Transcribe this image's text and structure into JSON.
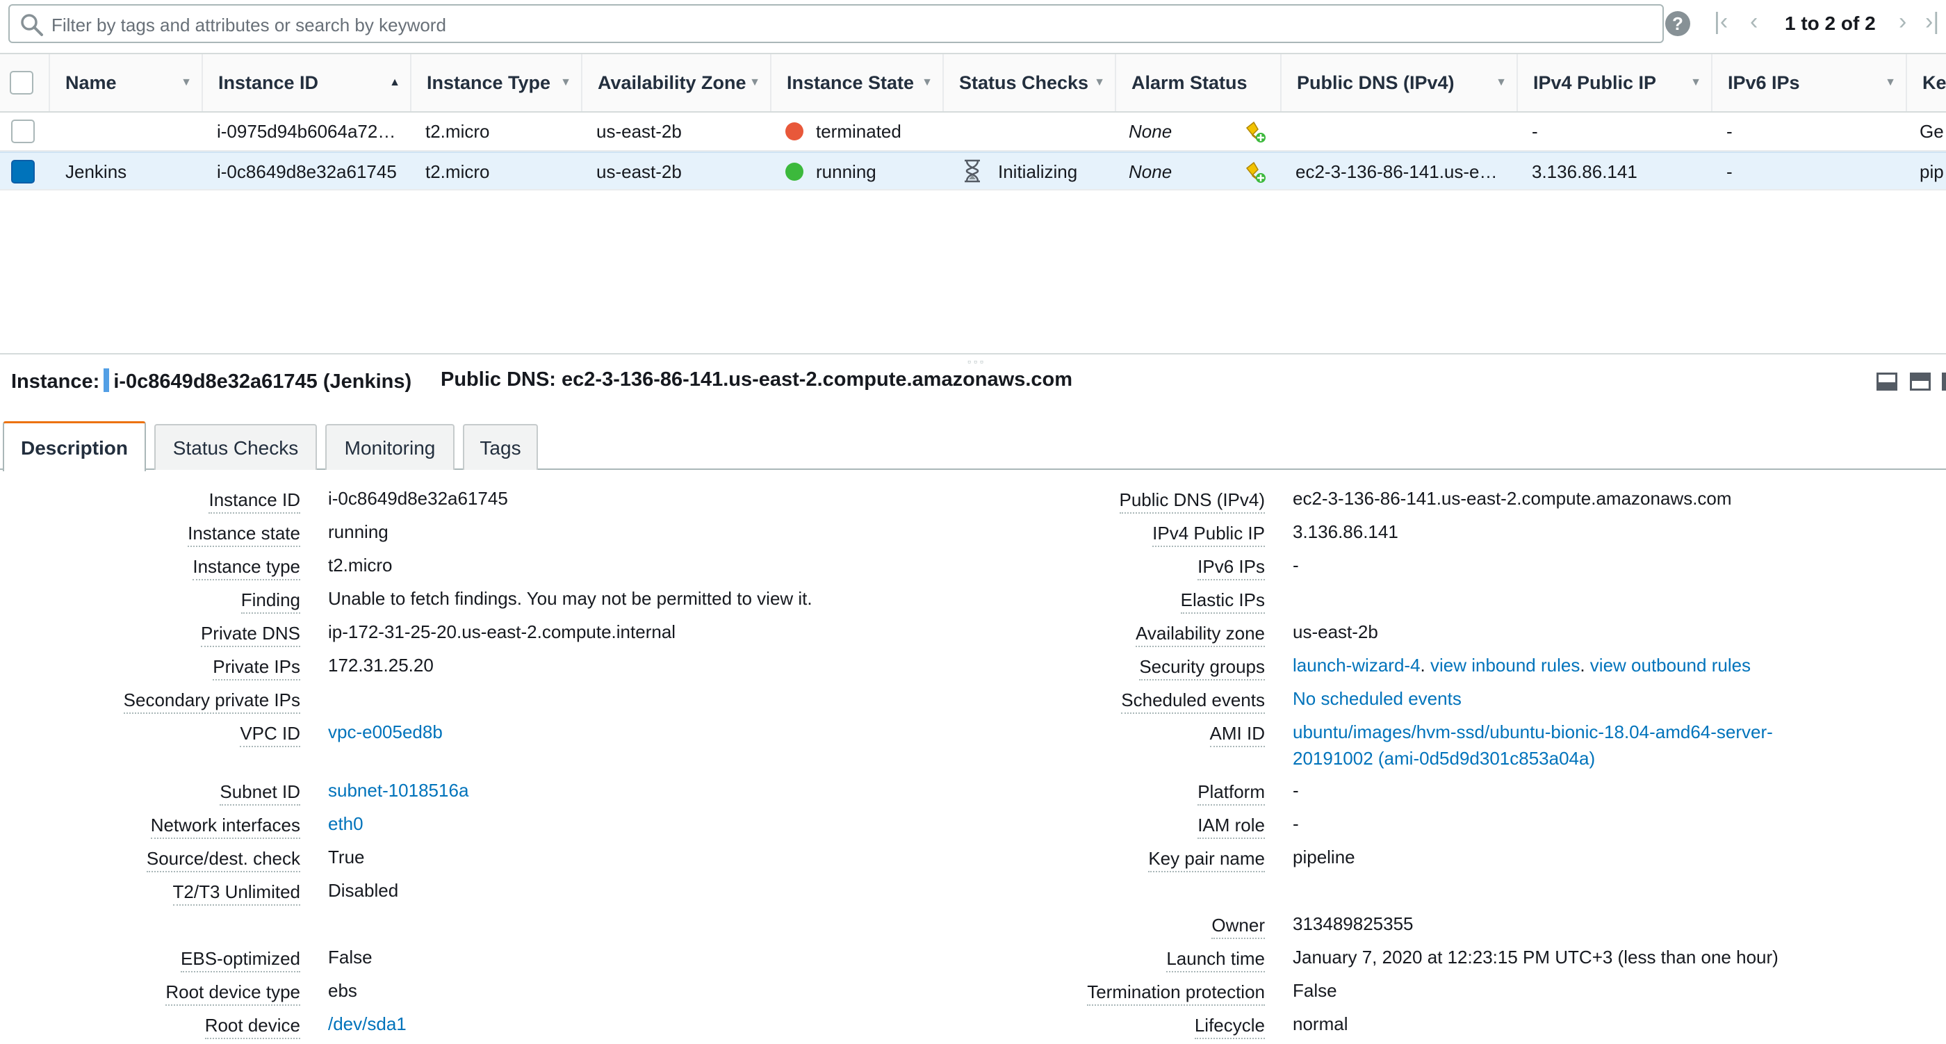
{
  "filter": {
    "placeholder": "Filter by tags and attributes or search by keyword",
    "pager_text": "1 to 2 of 2"
  },
  "grid": {
    "columns": [
      "Name",
      "Instance ID",
      "Instance Type",
      "Availability Zone",
      "Instance State",
      "Status Checks",
      "Alarm Status",
      "Public DNS (IPv4)",
      "IPv4 Public IP",
      "IPv6 IPs",
      "Ke"
    ],
    "rows": [
      {
        "name": "",
        "instance_id": "i-0975d94b6064a72…",
        "instance_type": "t2.micro",
        "az": "us-east-2b",
        "state": "terminated",
        "state_color": "#e8583a",
        "status_checks": "",
        "alarm": "None",
        "public_dns": "",
        "ipv4": "-",
        "ipv6": "-",
        "key": "Ge",
        "selected": false
      },
      {
        "name": "Jenkins",
        "instance_id": "i-0c8649d8e32a61745",
        "instance_type": "t2.micro",
        "az": "us-east-2b",
        "state": "running",
        "state_color": "#3cb93c",
        "status_checks": "Initializing",
        "alarm": "None",
        "public_dns": "ec2-3-136-86-141.us-e…",
        "ipv4": "3.136.86.141",
        "ipv6": "-",
        "key": "pip",
        "selected": true
      }
    ]
  },
  "instance_header": {
    "instance_label": "Instance:",
    "instance_value": "i-0c8649d8e32a61745 (Jenkins)",
    "dns_label": "Public DNS:",
    "dns_value": "ec2-3-136-86-141.us-east-2.compute.amazonaws.com"
  },
  "tabs": [
    "Description",
    "Status Checks",
    "Monitoring",
    "Tags"
  ],
  "description": {
    "left": [
      {
        "label": "Instance ID",
        "value": "i-0c8649d8e32a61745"
      },
      {
        "label": "Instance state",
        "value": "running"
      },
      {
        "label": "Instance type",
        "value": "t2.micro"
      },
      {
        "label": "Finding",
        "value": "Unable to fetch findings. You may not be permitted to view it."
      },
      {
        "label": "Private DNS",
        "value": "ip-172-31-25-20.us-east-2.compute.internal"
      },
      {
        "label": "Private IPs",
        "value": "172.31.25.20"
      },
      {
        "label": "Secondary private IPs",
        "value": ""
      },
      {
        "label": "VPC ID",
        "value": "vpc-e005ed8b"
      },
      {
        "label": "Subnet ID",
        "value": "subnet-1018516a"
      },
      {
        "label": "Network interfaces",
        "value": "eth0"
      },
      {
        "label": "Source/dest. check",
        "value": "True"
      },
      {
        "label": "T2/T3 Unlimited",
        "value": "Disabled"
      },
      {
        "label": "EBS-optimized",
        "value": "False"
      },
      {
        "label": "Root device type",
        "value": "ebs"
      },
      {
        "label": "Root device",
        "value": "/dev/sda1"
      }
    ],
    "right": [
      {
        "label": "Public DNS (IPv4)",
        "value": "ec2-3-136-86-141.us-east-2.compute.amazonaws.com"
      },
      {
        "label": "IPv4 Public IP",
        "value": "3.136.86.141"
      },
      {
        "label": "IPv6 IPs",
        "value": "-"
      },
      {
        "label": "Elastic IPs",
        "value": ""
      },
      {
        "label": "Availability zone",
        "value": "us-east-2b"
      },
      {
        "label": "Security groups",
        "value": "launch-wizard-4",
        "extra1": "view inbound rules",
        "extra2": "view outbound rules"
      },
      {
        "label": "Scheduled events",
        "value": "No scheduled events"
      },
      {
        "label": "AMI ID",
        "value": "ubuntu/images/hvm-ssd/ubuntu-bionic-18.04-amd64-server-",
        "value2": "20191002 (ami-0d5d9d301c853a04a)"
      },
      {
        "label": "Platform",
        "value": "-"
      },
      {
        "label": "IAM role",
        "value": "-"
      },
      {
        "label": "Key pair name",
        "value": "pipeline"
      },
      {
        "label": "Owner",
        "value": "313489825355"
      },
      {
        "label": "Launch time",
        "value": "January 7, 2020 at 12:23:15 PM UTC+3 (less than one hour)"
      },
      {
        "label": "Termination protection",
        "value": "False"
      },
      {
        "label": "Lifecycle",
        "value": "normal"
      }
    ]
  }
}
